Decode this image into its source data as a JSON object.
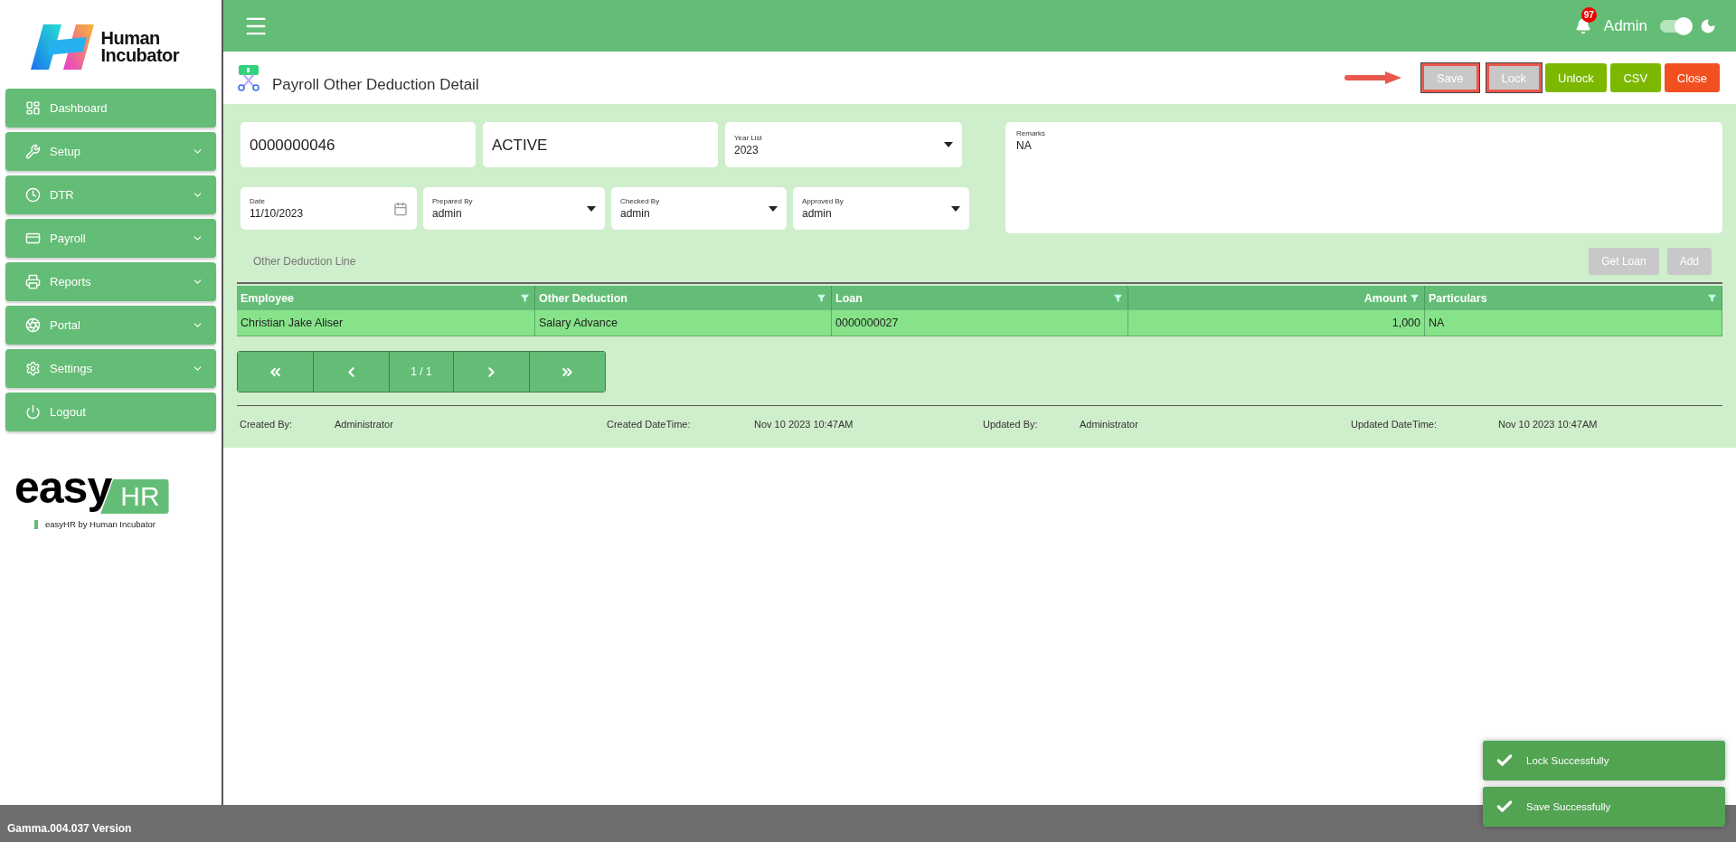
{
  "brand": {
    "name": "Human Incubator"
  },
  "sidebar": {
    "items": [
      {
        "label": "Dashboard",
        "expandable": false
      },
      {
        "label": "Setup",
        "expandable": true
      },
      {
        "label": "DTR",
        "expandable": true
      },
      {
        "label": "Payroll",
        "expandable": true
      },
      {
        "label": "Reports",
        "expandable": true
      },
      {
        "label": "Portal",
        "expandable": true
      },
      {
        "label": "Settings",
        "expandable": true
      },
      {
        "label": "Logout",
        "expandable": false
      }
    ]
  },
  "product_logo": {
    "word": "easy",
    "badge": "HR",
    "tagline": "easyHR by Human Incubator"
  },
  "header": {
    "notification_count": "97",
    "user": "Admin",
    "dark_mode": {
      "on": true
    }
  },
  "page": {
    "title": "Payroll Other Deduction Detail"
  },
  "toolbar": [
    {
      "label": "Save",
      "kind": "disabled",
      "highlighted": true
    },
    {
      "label": "Lock",
      "kind": "disabled",
      "highlighted": true
    },
    {
      "label": "Unlock",
      "kind": "action",
      "highlighted": false
    },
    {
      "label": "CSV",
      "kind": "action",
      "highlighted": false
    },
    {
      "label": "Close",
      "kind": "danger",
      "highlighted": false
    }
  ],
  "form": {
    "row_1": [
      {
        "kind": "text",
        "value": "0000000046"
      },
      {
        "kind": "text",
        "value": "ACTIVE"
      },
      {
        "kind": "select",
        "label": "Year List",
        "value": "2023"
      }
    ],
    "row_2": [
      {
        "kind": "date",
        "label": "Date",
        "value": "11/10/2023"
      },
      {
        "kind": "select",
        "label": "Prepared By",
        "value": "admin"
      },
      {
        "kind": "select",
        "label": "Checked By",
        "value": "admin"
      },
      {
        "kind": "select",
        "label": "Approved By",
        "value": "admin"
      }
    ],
    "remarks": {
      "label": "Remarks",
      "value": "NA"
    }
  },
  "lines": {
    "title": "Other Deduction Line",
    "buttons": [
      {
        "label": "Get Loan",
        "disabled": true
      },
      {
        "label": "Add",
        "disabled": true
      }
    ]
  },
  "table": {
    "columns": [
      {
        "label": "Employee",
        "right_aligned": false
      },
      {
        "label": "Other Deduction",
        "right_aligned": false
      },
      {
        "label": "Loan",
        "right_aligned": false
      },
      {
        "label": "Amount",
        "right_aligned": true
      },
      {
        "label": "Particulars",
        "right_aligned": false
      }
    ],
    "rows": [
      [
        "Christian Jake Aliser",
        "Salary Advance",
        "0000000027",
        "1,000",
        "NA"
      ]
    ]
  },
  "pager": {
    "page": "1 / 1"
  },
  "audit": [
    {
      "label": "Created By:",
      "value": "Administrator"
    },
    {
      "label": "Created DateTime:",
      "value": "Nov 10 2023 10:47AM"
    },
    {
      "label": "Updated By:",
      "value": "Administrator"
    },
    {
      "label": "Updated DateTime:",
      "value": "Nov 10 2023 10:47AM"
    }
  ],
  "status_bar": {
    "version": "Gamma.004.037 Version"
  },
  "toasts": [
    {
      "message": "Lock Successfully"
    },
    {
      "message": "Save Successfully"
    }
  ]
}
